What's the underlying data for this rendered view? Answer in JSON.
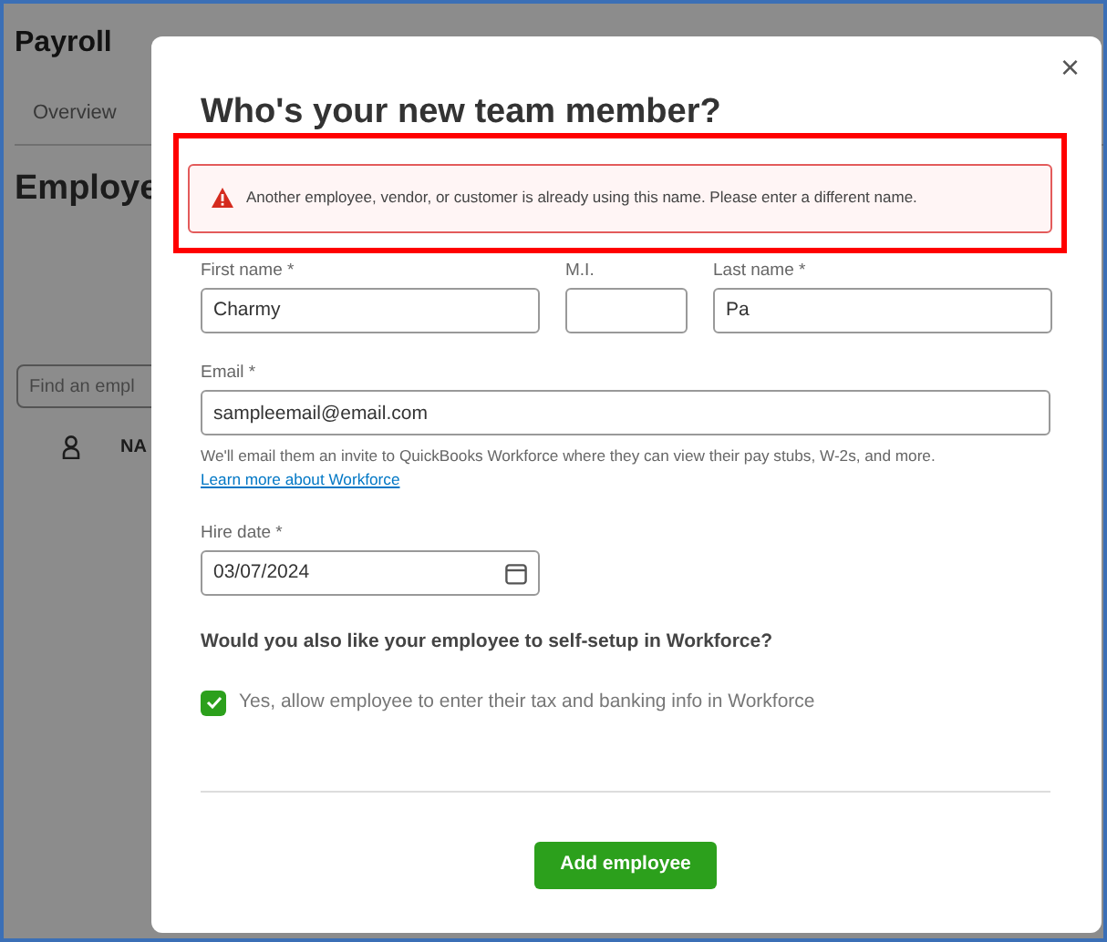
{
  "background": {
    "title": "Payroll",
    "tabs": [
      {
        "label": "Overview",
        "selected": false
      }
    ],
    "heading": "Employe",
    "search": {
      "placeholder": "Find an empl"
    },
    "column_2": "NA"
  },
  "dialog": {
    "title": "Who's your new team member?",
    "close": "×",
    "error": "Another employee, vendor, or customer is already using this name. Please enter a different name.",
    "fields": [
      {
        "label": "First name *",
        "value": "Charmy"
      },
      {
        "label": "M.I."
      },
      {
        "label": "Last name *",
        "value": "Pa"
      }
    ],
    "email": {
      "label": "Email *",
      "value": "sampleemail@email.com"
    },
    "email_help": "We'll email them an invite to QuickBooks Workforce where they can view their pay stubs, W-2s, and more.",
    "learn_more": "Learn more about Workforce",
    "hire_date": {
      "label": "Hire date *",
      "value": "03/07/2024"
    },
    "question": "Would you also like your employee to self-setup in Workforce?",
    "self_setup": {
      "label": "Yes, allow employee to enter their tax and banking info in Workforce",
      "checked": true
    },
    "submit": "Add employee"
  }
}
